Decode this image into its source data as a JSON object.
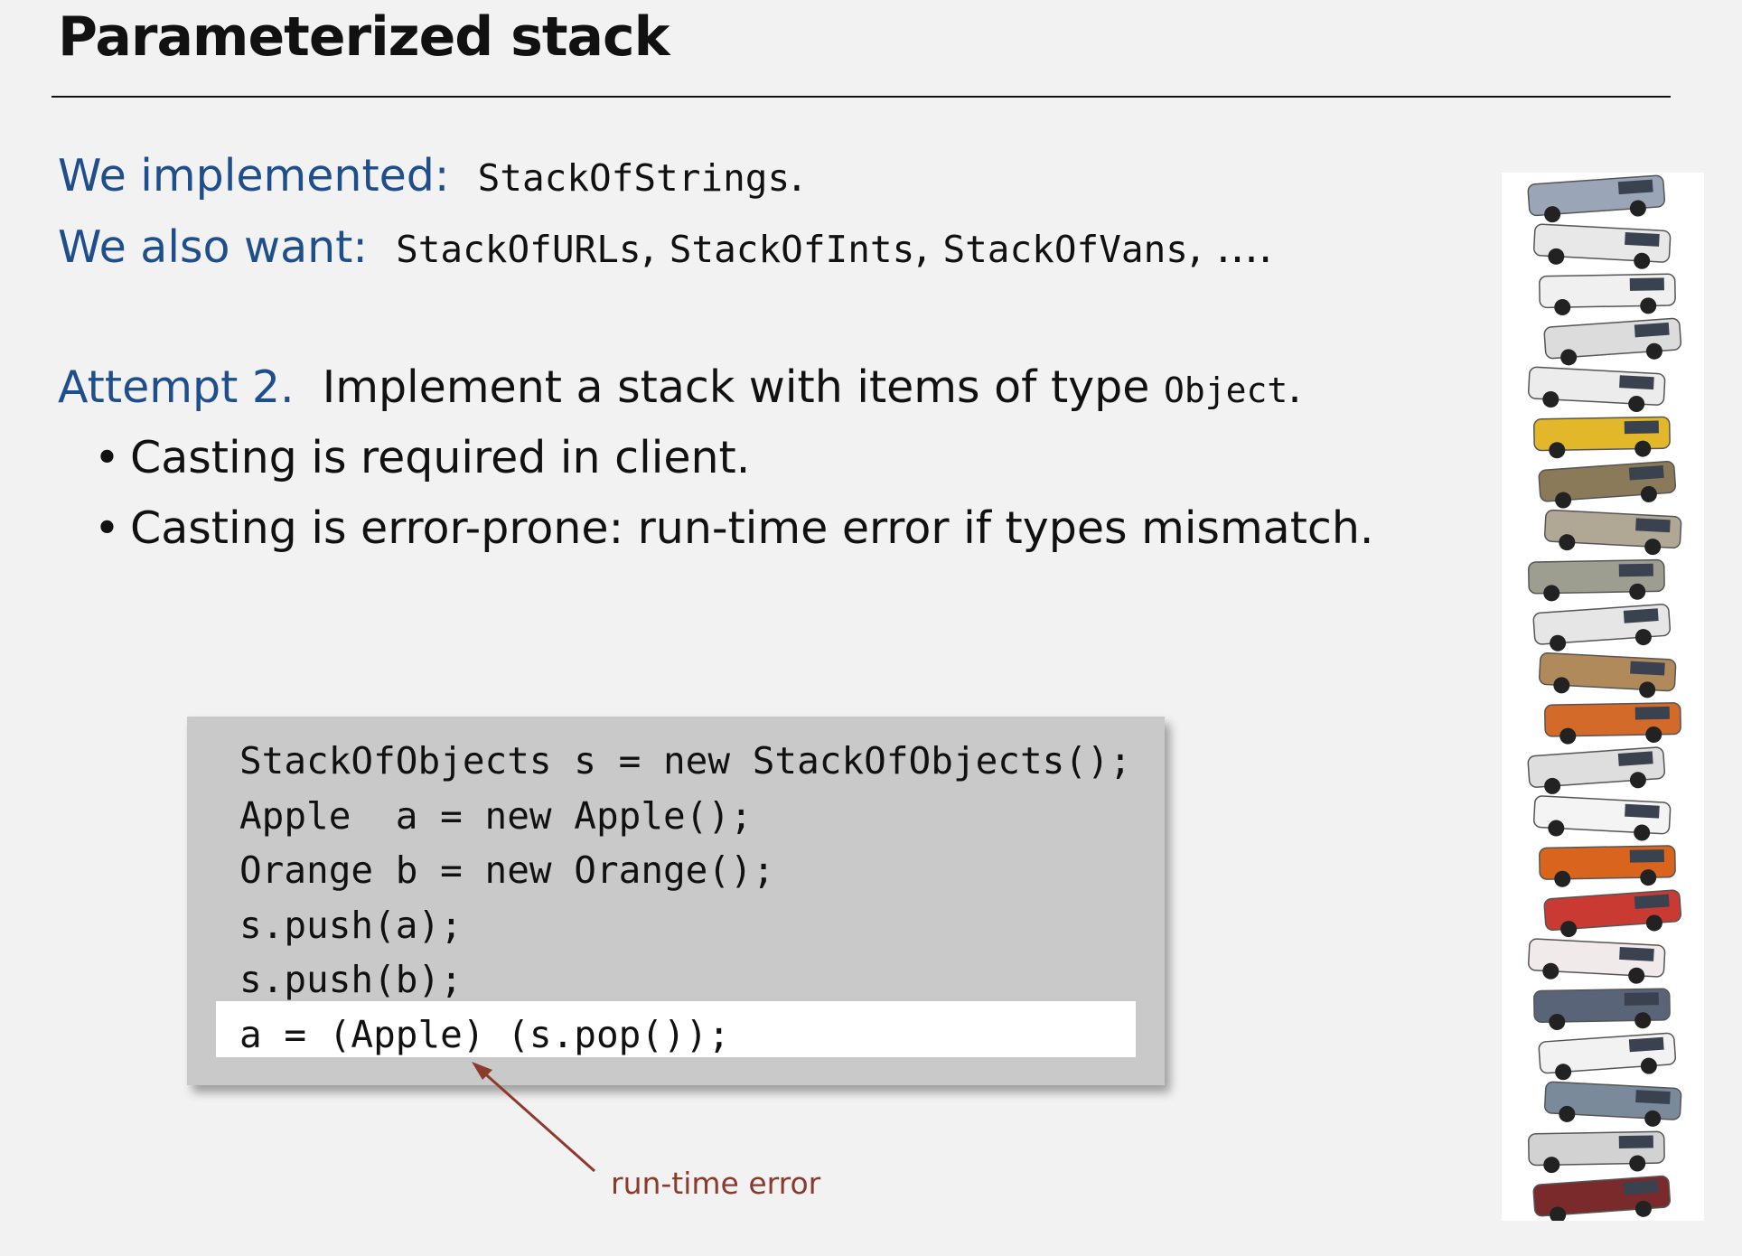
{
  "title": "Parameterized stack",
  "lines": {
    "implemented_label": "We implemented:",
    "implemented_code": "StackOfStrings",
    "implemented_end": ".",
    "want_label": "We also want:",
    "want_code1": "StackOfURLs",
    "want_code2": "StackOfInts",
    "want_code3": "StackOfVans",
    "want_sep": ", ",
    "want_end": ", ....",
    "attempt_label": "Attempt 2.",
    "attempt_text": "Implement a stack with items of type",
    "attempt_code": "Object",
    "attempt_end": "."
  },
  "bullets": [
    "Casting is required in client.",
    "Casting is error-prone:  run-time error if types mismatch."
  ],
  "code": [
    "StackOfObjects s = new StackOfObjects();",
    "Apple  a = new Apple();",
    "Orange b = new Orange();",
    "s.push(a);",
    "s.push(b);",
    "a = (Apple) (s.pop());"
  ],
  "annotation": "run-time error",
  "colors": {
    "heading_blue": "#1f4e8c",
    "annotation_red": "#8b3a2b",
    "code_box": "#c9c9c9",
    "highlight": "#ffffff"
  }
}
